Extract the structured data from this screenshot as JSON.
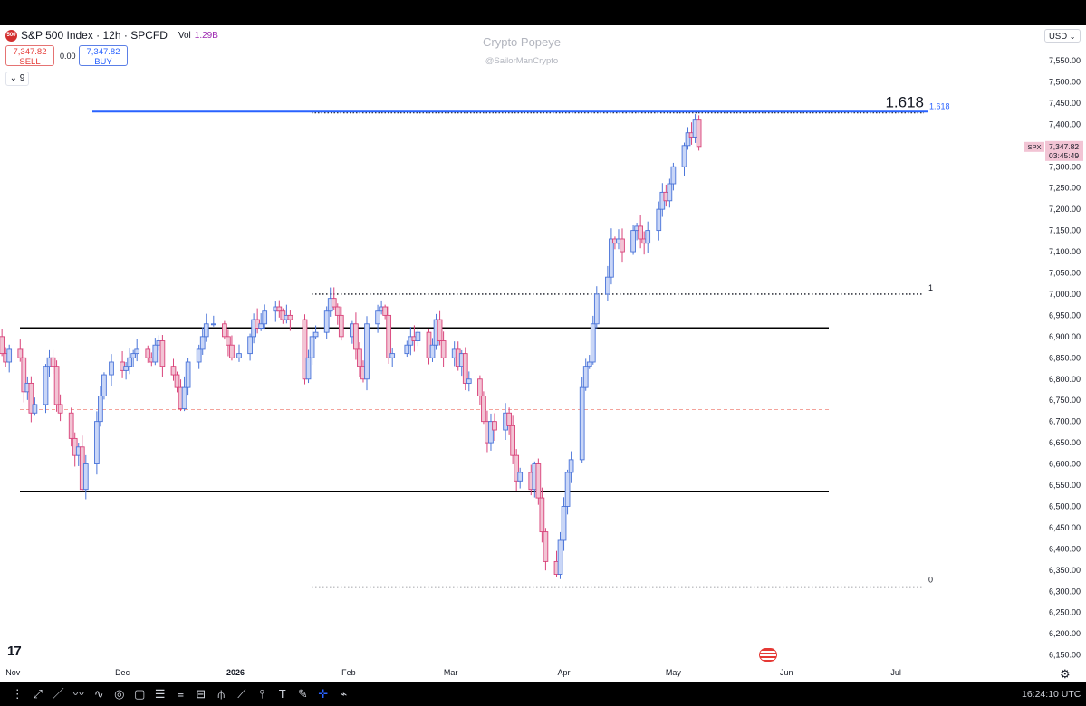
{
  "header": {
    "badge": "500",
    "title": "S&P 500 Index · 12h · SPCFD",
    "vol_label": "Vol",
    "vol_value": "1.29B",
    "sell_price": "7,347.82",
    "sell_label": "SELL",
    "spread": "0.00",
    "buy_price": "7,347.82",
    "buy_label": "BUY",
    "indicator_label": "9",
    "currency": "USD"
  },
  "watermark": {
    "name": "Crypto Popeye",
    "handle": "@SailorManCrypto"
  },
  "fib": {
    "label_top": "1.618",
    "label_top_axis": "1.618",
    "label_mid": "1",
    "label_bottom": "0"
  },
  "price_tag": {
    "symbol": "SPX",
    "price": "7,347.82",
    "countdown": "03:45:49"
  },
  "footer": {
    "time": "16:24:10 UTC"
  },
  "colors": {
    "up": "#4a74d9",
    "down": "#d9437a",
    "up_fill": "#c9d6f7",
    "down_fill": "#f2c4d4",
    "fib_top": "#2962ff",
    "mid_dashed": "#f4a39b",
    "support": "#000000"
  },
  "toolbar": {
    "icons": [
      "dots-icon",
      "cursor-icon",
      "trendline-icon",
      "path-icon",
      "brush-icon",
      "circle-icon",
      "rectangle-icon",
      "fib-icon",
      "parallel-icon",
      "gann-icon",
      "pitchfork-icon",
      "pattern-icon",
      "projection-icon",
      "text-icon",
      "annotation-icon",
      "crosshair-icon",
      "measure-icon"
    ]
  },
  "chart_data": {
    "type": "candlestick",
    "symbol": "SPX",
    "timeframe": "12h",
    "y_ticks": [
      7550,
      7500,
      7450,
      7400,
      7350,
      7300,
      7250,
      7200,
      7150,
      7100,
      7050,
      7000,
      6950,
      6900,
      6850,
      6800,
      6750,
      6700,
      6650,
      6600,
      6550,
      6500,
      6450,
      6400,
      6350,
      6300,
      6250,
      6200,
      6150
    ],
    "ylim": [
      6125,
      7575
    ],
    "x_ticks": [
      "Nov",
      "Dec",
      "2026",
      "Feb",
      "Mar",
      "Apr",
      "May",
      "Jun",
      "Jul"
    ],
    "x_tick_dates": [
      "2025-11-01",
      "2025-12-01",
      "2026-01-01",
      "2026-02-01",
      "2026-03-01",
      "2026-04-01",
      "2026-05-01",
      "2026-06-01",
      "2026-07-01"
    ],
    "xlim": [
      "2025-10-24",
      "2026-07-31"
    ],
    "last_price": 7347.82,
    "horizontal_levels": [
      {
        "type": "fib",
        "ratio": 1.618,
        "value": 7430
      },
      {
        "type": "fib",
        "ratio": 1,
        "value": 7000
      },
      {
        "type": "fib",
        "ratio": 0,
        "value": 6310
      },
      {
        "type": "support_resistance",
        "value": 6920
      },
      {
        "type": "support_resistance",
        "value": 6535
      },
      {
        "type": "dashed",
        "value": 6728
      }
    ],
    "close_series": [
      {
        "date": "2025-10-27",
        "close": 6880
      },
      {
        "date": "2025-10-28",
        "close": 6900
      },
      {
        "date": "2025-10-29",
        "close": 6860
      },
      {
        "date": "2025-10-30",
        "close": 6840
      },
      {
        "date": "2025-10-31",
        "close": 6870
      },
      {
        "date": "2025-11-03",
        "close": 6850
      },
      {
        "date": "2025-11-04",
        "close": 6770
      },
      {
        "date": "2025-11-05",
        "close": 6790
      },
      {
        "date": "2025-11-06",
        "close": 6720
      },
      {
        "date": "2025-11-07",
        "close": 6740
      },
      {
        "date": "2025-11-10",
        "close": 6830
      },
      {
        "date": "2025-11-11",
        "close": 6850
      },
      {
        "date": "2025-11-12",
        "close": 6830
      },
      {
        "date": "2025-11-13",
        "close": 6740
      },
      {
        "date": "2025-11-14",
        "close": 6720
      },
      {
        "date": "2025-11-17",
        "close": 6660
      },
      {
        "date": "2025-11-18",
        "close": 6620
      },
      {
        "date": "2025-11-19",
        "close": 6640
      },
      {
        "date": "2025-11-20",
        "close": 6540
      },
      {
        "date": "2025-11-21",
        "close": 6600
      },
      {
        "date": "2025-11-24",
        "close": 6700
      },
      {
        "date": "2025-11-25",
        "close": 6760
      },
      {
        "date": "2025-11-26",
        "close": 6810
      },
      {
        "date": "2025-11-28",
        "close": 6840
      },
      {
        "date": "2025-12-01",
        "close": 6820
      },
      {
        "date": "2025-12-02",
        "close": 6830
      },
      {
        "date": "2025-12-03",
        "close": 6850
      },
      {
        "date": "2025-12-04",
        "close": 6860
      },
      {
        "date": "2025-12-05",
        "close": 6870
      },
      {
        "date": "2025-12-08",
        "close": 6850
      },
      {
        "date": "2025-12-09",
        "close": 6840
      },
      {
        "date": "2025-12-10",
        "close": 6880
      },
      {
        "date": "2025-12-11",
        "close": 6890
      },
      {
        "date": "2025-12-12",
        "close": 6830
      },
      {
        "date": "2025-12-15",
        "close": 6810
      },
      {
        "date": "2025-12-16",
        "close": 6780
      },
      {
        "date": "2025-12-17",
        "close": 6730
      },
      {
        "date": "2025-12-18",
        "close": 6780
      },
      {
        "date": "2025-12-19",
        "close": 6840
      },
      {
        "date": "2025-12-22",
        "close": 6870
      },
      {
        "date": "2025-12-23",
        "close": 6900
      },
      {
        "date": "2025-12-24",
        "close": 6930
      },
      {
        "date": "2025-12-26",
        "close": 6930
      },
      {
        "date": "2025-12-29",
        "close": 6900
      },
      {
        "date": "2025-12-30",
        "close": 6880
      },
      {
        "date": "2025-12-31",
        "close": 6850
      },
      {
        "date": "2026-01-02",
        "close": 6860
      },
      {
        "date": "2026-01-05",
        "close": 6900
      },
      {
        "date": "2026-01-06",
        "close": 6940
      },
      {
        "date": "2026-01-07",
        "close": 6920
      },
      {
        "date": "2026-01-08",
        "close": 6930
      },
      {
        "date": "2026-01-09",
        "close": 6960
      },
      {
        "date": "2026-01-12",
        "close": 6970
      },
      {
        "date": "2026-01-13",
        "close": 6960
      },
      {
        "date": "2026-01-14",
        "close": 6940
      },
      {
        "date": "2026-01-15",
        "close": 6950
      },
      {
        "date": "2026-01-16",
        "close": 6940
      },
      {
        "date": "2026-01-20",
        "close": 6800
      },
      {
        "date": "2026-01-21",
        "close": 6850
      },
      {
        "date": "2026-01-22",
        "close": 6900
      },
      {
        "date": "2026-01-23",
        "close": 6910
      },
      {
        "date": "2026-01-26",
        "close": 6960
      },
      {
        "date": "2026-01-27",
        "close": 6990
      },
      {
        "date": "2026-01-28",
        "close": 6970
      },
      {
        "date": "2026-01-29",
        "close": 6950
      },
      {
        "date": "2026-01-30",
        "close": 6900
      },
      {
        "date": "2026-02-02",
        "close": 6930
      },
      {
        "date": "2026-02-03",
        "close": 6870
      },
      {
        "date": "2026-02-04",
        "close": 6830
      },
      {
        "date": "2026-02-05",
        "close": 6800
      },
      {
        "date": "2026-02-06",
        "close": 6930
      },
      {
        "date": "2026-02-09",
        "close": 6960
      },
      {
        "date": "2026-02-10",
        "close": 6970
      },
      {
        "date": "2026-02-11",
        "close": 6950
      },
      {
        "date": "2026-02-12",
        "close": 6850
      },
      {
        "date": "2026-02-13",
        "close": 6860
      },
      {
        "date": "2026-02-17",
        "close": 6880
      },
      {
        "date": "2026-02-18",
        "close": 6900
      },
      {
        "date": "2026-02-19",
        "close": 6890
      },
      {
        "date": "2026-02-20",
        "close": 6910
      },
      {
        "date": "2026-02-23",
        "close": 6850
      },
      {
        "date": "2026-02-24",
        "close": 6880
      },
      {
        "date": "2026-02-25",
        "close": 6940
      },
      {
        "date": "2026-02-26",
        "close": 6890
      },
      {
        "date": "2026-02-27",
        "close": 6850
      },
      {
        "date": "2026-03-02",
        "close": 6870
      },
      {
        "date": "2026-03-03",
        "close": 6830
      },
      {
        "date": "2026-03-04",
        "close": 6860
      },
      {
        "date": "2026-03-05",
        "close": 6790
      },
      {
        "date": "2026-03-06",
        "close": 6800
      },
      {
        "date": "2026-03-09",
        "close": 6760
      },
      {
        "date": "2026-03-10",
        "close": 6700
      },
      {
        "date": "2026-03-11",
        "close": 6650
      },
      {
        "date": "2026-03-12",
        "close": 6700
      },
      {
        "date": "2026-03-13",
        "close": 6680
      },
      {
        "date": "2026-03-16",
        "close": 6720
      },
      {
        "date": "2026-03-17",
        "close": 6690
      },
      {
        "date": "2026-03-18",
        "close": 6620
      },
      {
        "date": "2026-03-19",
        "close": 6560
      },
      {
        "date": "2026-03-20",
        "close": 6580
      },
      {
        "date": "2026-03-23",
        "close": 6540
      },
      {
        "date": "2026-03-24",
        "close": 6600
      },
      {
        "date": "2026-03-25",
        "close": 6520
      },
      {
        "date": "2026-03-26",
        "close": 6440
      },
      {
        "date": "2026-03-27",
        "close": 6370
      },
      {
        "date": "2026-03-30",
        "close": 6340
      },
      {
        "date": "2026-03-31",
        "close": 6420
      },
      {
        "date": "2026-04-01",
        "close": 6500
      },
      {
        "date": "2026-04-02",
        "close": 6580
      },
      {
        "date": "2026-04-03",
        "close": 6610
      },
      {
        "date": "2026-04-06",
        "close": 6780
      },
      {
        "date": "2026-04-07",
        "close": 6830
      },
      {
        "date": "2026-04-08",
        "close": 6840
      },
      {
        "date": "2026-04-09",
        "close": 6930
      },
      {
        "date": "2026-04-10",
        "close": 7000
      },
      {
        "date": "2026-04-13",
        "close": 7040
      },
      {
        "date": "2026-04-14",
        "close": 7130
      },
      {
        "date": "2026-04-15",
        "close": 7120
      },
      {
        "date": "2026-04-16",
        "close": 7130
      },
      {
        "date": "2026-04-17",
        "close": 7100
      },
      {
        "date": "2026-04-20",
        "close": 7150
      },
      {
        "date": "2026-04-21",
        "close": 7160
      },
      {
        "date": "2026-04-22",
        "close": 7130
      },
      {
        "date": "2026-04-23",
        "close": 7120
      },
      {
        "date": "2026-04-24",
        "close": 7150
      },
      {
        "date": "2026-04-27",
        "close": 7200
      },
      {
        "date": "2026-04-28",
        "close": 7240
      },
      {
        "date": "2026-04-29",
        "close": 7220
      },
      {
        "date": "2026-04-30",
        "close": 7260
      },
      {
        "date": "2026-05-01",
        "close": 7300
      },
      {
        "date": "2026-05-04",
        "close": 7350
      },
      {
        "date": "2026-05-05",
        "close": 7380
      },
      {
        "date": "2026-05-06",
        "close": 7370
      },
      {
        "date": "2026-05-07",
        "close": 7410
      },
      {
        "date": "2026-05-08",
        "close": 7347.82
      }
    ]
  }
}
